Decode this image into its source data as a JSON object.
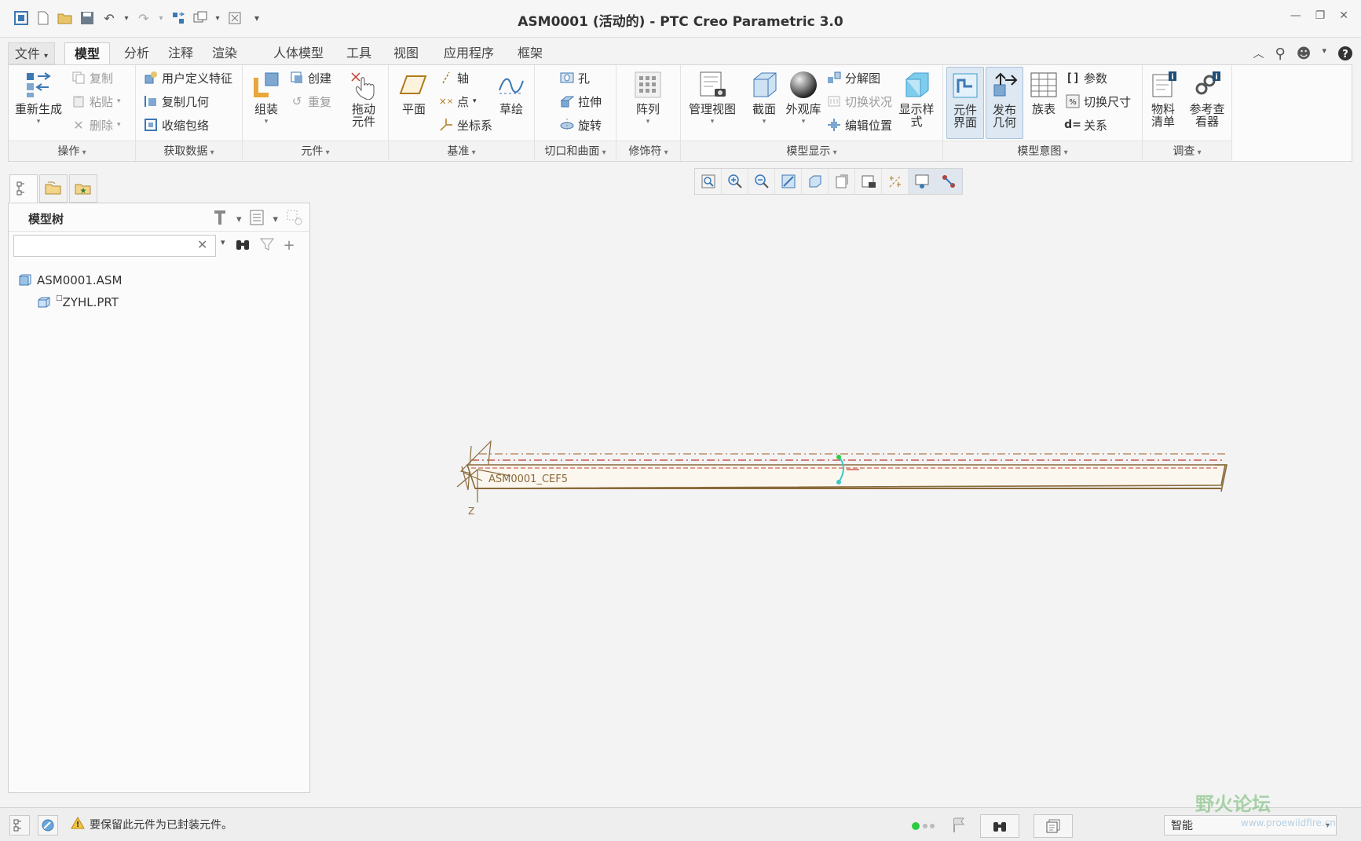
{
  "window": {
    "title": "ASM0001 (活动的) - PTC Creo Parametric 3.0"
  },
  "tabs": [
    "文件",
    "模型",
    "分析",
    "注释",
    "渲染",
    "人体模型",
    "工具",
    "视图",
    "应用程序",
    "框架"
  ],
  "active_tab": "模型",
  "ribbon": {
    "groups": {
      "operations": {
        "label": "操作",
        "regenerate": "重新生成",
        "copy": "复制",
        "paste": "粘贴",
        "delete": "删除"
      },
      "get_data": {
        "label": "获取数据",
        "udf": "用户定义特征",
        "copy_geom": "复制几何",
        "shrinkwrap": "收缩包络"
      },
      "component": {
        "label": "元件",
        "assemble": "组装",
        "create": "创建",
        "repeat": "重复",
        "drag_line1": "拖动",
        "drag_line2": "元件"
      },
      "datum": {
        "label": "基准",
        "plane": "平面",
        "axis": "轴",
        "point": "点",
        "csys": "坐标系",
        "sketch": "草绘"
      },
      "cut_surface": {
        "label": "切口和曲面",
        "hole": "孔",
        "extrude": "拉伸",
        "revolve": "旋转"
      },
      "modifiers": {
        "label": "修饰符",
        "pattern": "阵列"
      },
      "model_display": {
        "label": "模型显示",
        "manage_views": "管理视图",
        "section": "截面",
        "appearance": "外观库",
        "exploded": "分解图",
        "toggle_status": "切换状况",
        "edit_position": "编辑位置",
        "display_style_line1": "显示样",
        "display_style_line2": "式"
      },
      "model_intent": {
        "label": "模型意图",
        "comp_interface_line1": "元件",
        "comp_interface_line2": "界面",
        "publish_geom_line1": "发布",
        "publish_geom_line2": "几何",
        "family_table": "族表",
        "parameters": "参数",
        "switch_dims": "切换尺寸",
        "relations": "关系"
      },
      "investigate": {
        "label": "调查",
        "bom_line1": "物料",
        "bom_line2": "清单",
        "ref_viewer_line1": "参考查",
        "ref_viewer_line2": "看器"
      }
    }
  },
  "model_tree": {
    "title": "模型树",
    "search_value": "",
    "items": [
      "ASM0001.ASM",
      "ZYHL.PRT"
    ]
  },
  "graphics": {
    "datum_label": "ASM0001_CEF5",
    "axis_label": "Z"
  },
  "status": {
    "message": "要保留此元件为已封装元件。",
    "filter": "智能"
  },
  "watermark": {
    "text": "野火论坛",
    "url": "www.proewildfire.cn"
  },
  "colors": {
    "accent": "#3c78b4",
    "model_edge": "#8a6a3a",
    "datum": "#c0392b"
  }
}
